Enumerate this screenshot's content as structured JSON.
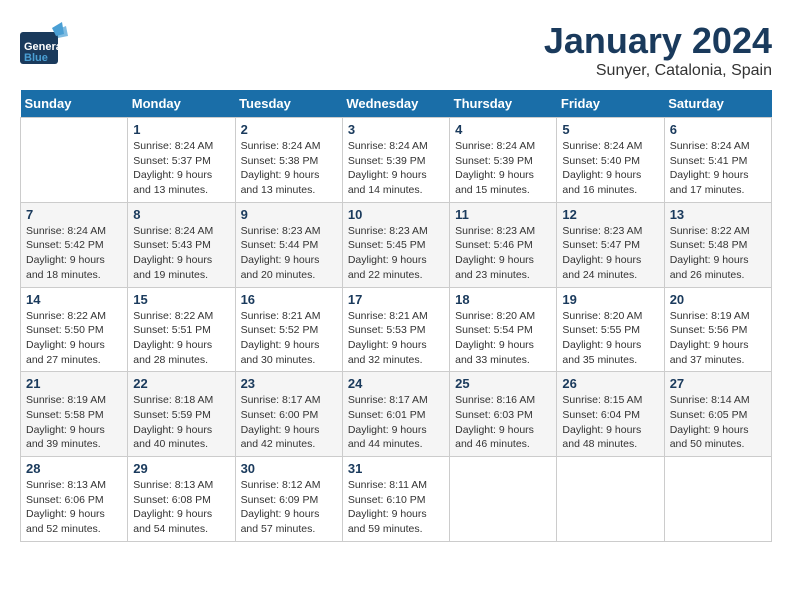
{
  "header": {
    "logo_general": "General",
    "logo_blue": "Blue",
    "month": "January 2024",
    "location": "Sunyer, Catalonia, Spain"
  },
  "days_of_week": [
    "Sunday",
    "Monday",
    "Tuesday",
    "Wednesday",
    "Thursday",
    "Friday",
    "Saturday"
  ],
  "weeks": [
    [
      {
        "day": "",
        "empty": true
      },
      {
        "day": "1",
        "sunrise": "Sunrise: 8:24 AM",
        "sunset": "Sunset: 5:37 PM",
        "daylight": "Daylight: 9 hours and 13 minutes."
      },
      {
        "day": "2",
        "sunrise": "Sunrise: 8:24 AM",
        "sunset": "Sunset: 5:38 PM",
        "daylight": "Daylight: 9 hours and 13 minutes."
      },
      {
        "day": "3",
        "sunrise": "Sunrise: 8:24 AM",
        "sunset": "Sunset: 5:39 PM",
        "daylight": "Daylight: 9 hours and 14 minutes."
      },
      {
        "day": "4",
        "sunrise": "Sunrise: 8:24 AM",
        "sunset": "Sunset: 5:39 PM",
        "daylight": "Daylight: 9 hours and 15 minutes."
      },
      {
        "day": "5",
        "sunrise": "Sunrise: 8:24 AM",
        "sunset": "Sunset: 5:40 PM",
        "daylight": "Daylight: 9 hours and 16 minutes."
      },
      {
        "day": "6",
        "sunrise": "Sunrise: 8:24 AM",
        "sunset": "Sunset: 5:41 PM",
        "daylight": "Daylight: 9 hours and 17 minutes."
      }
    ],
    [
      {
        "day": "7",
        "sunrise": "Sunrise: 8:24 AM",
        "sunset": "Sunset: 5:42 PM",
        "daylight": "Daylight: 9 hours and 18 minutes."
      },
      {
        "day": "8",
        "sunrise": "Sunrise: 8:24 AM",
        "sunset": "Sunset: 5:43 PM",
        "daylight": "Daylight: 9 hours and 19 minutes."
      },
      {
        "day": "9",
        "sunrise": "Sunrise: 8:23 AM",
        "sunset": "Sunset: 5:44 PM",
        "daylight": "Daylight: 9 hours and 20 minutes."
      },
      {
        "day": "10",
        "sunrise": "Sunrise: 8:23 AM",
        "sunset": "Sunset: 5:45 PM",
        "daylight": "Daylight: 9 hours and 22 minutes."
      },
      {
        "day": "11",
        "sunrise": "Sunrise: 8:23 AM",
        "sunset": "Sunset: 5:46 PM",
        "daylight": "Daylight: 9 hours and 23 minutes."
      },
      {
        "day": "12",
        "sunrise": "Sunrise: 8:23 AM",
        "sunset": "Sunset: 5:47 PM",
        "daylight": "Daylight: 9 hours and 24 minutes."
      },
      {
        "day": "13",
        "sunrise": "Sunrise: 8:22 AM",
        "sunset": "Sunset: 5:48 PM",
        "daylight": "Daylight: 9 hours and 26 minutes."
      }
    ],
    [
      {
        "day": "14",
        "sunrise": "Sunrise: 8:22 AM",
        "sunset": "Sunset: 5:50 PM",
        "daylight": "Daylight: 9 hours and 27 minutes."
      },
      {
        "day": "15",
        "sunrise": "Sunrise: 8:22 AM",
        "sunset": "Sunset: 5:51 PM",
        "daylight": "Daylight: 9 hours and 28 minutes."
      },
      {
        "day": "16",
        "sunrise": "Sunrise: 8:21 AM",
        "sunset": "Sunset: 5:52 PM",
        "daylight": "Daylight: 9 hours and 30 minutes."
      },
      {
        "day": "17",
        "sunrise": "Sunrise: 8:21 AM",
        "sunset": "Sunset: 5:53 PM",
        "daylight": "Daylight: 9 hours and 32 minutes."
      },
      {
        "day": "18",
        "sunrise": "Sunrise: 8:20 AM",
        "sunset": "Sunset: 5:54 PM",
        "daylight": "Daylight: 9 hours and 33 minutes."
      },
      {
        "day": "19",
        "sunrise": "Sunrise: 8:20 AM",
        "sunset": "Sunset: 5:55 PM",
        "daylight": "Daylight: 9 hours and 35 minutes."
      },
      {
        "day": "20",
        "sunrise": "Sunrise: 8:19 AM",
        "sunset": "Sunset: 5:56 PM",
        "daylight": "Daylight: 9 hours and 37 minutes."
      }
    ],
    [
      {
        "day": "21",
        "sunrise": "Sunrise: 8:19 AM",
        "sunset": "Sunset: 5:58 PM",
        "daylight": "Daylight: 9 hours and 39 minutes."
      },
      {
        "day": "22",
        "sunrise": "Sunrise: 8:18 AM",
        "sunset": "Sunset: 5:59 PM",
        "daylight": "Daylight: 9 hours and 40 minutes."
      },
      {
        "day": "23",
        "sunrise": "Sunrise: 8:17 AM",
        "sunset": "Sunset: 6:00 PM",
        "daylight": "Daylight: 9 hours and 42 minutes."
      },
      {
        "day": "24",
        "sunrise": "Sunrise: 8:17 AM",
        "sunset": "Sunset: 6:01 PM",
        "daylight": "Daylight: 9 hours and 44 minutes."
      },
      {
        "day": "25",
        "sunrise": "Sunrise: 8:16 AM",
        "sunset": "Sunset: 6:03 PM",
        "daylight": "Daylight: 9 hours and 46 minutes."
      },
      {
        "day": "26",
        "sunrise": "Sunrise: 8:15 AM",
        "sunset": "Sunset: 6:04 PM",
        "daylight": "Daylight: 9 hours and 48 minutes."
      },
      {
        "day": "27",
        "sunrise": "Sunrise: 8:14 AM",
        "sunset": "Sunset: 6:05 PM",
        "daylight": "Daylight: 9 hours and 50 minutes."
      }
    ],
    [
      {
        "day": "28",
        "sunrise": "Sunrise: 8:13 AM",
        "sunset": "Sunset: 6:06 PM",
        "daylight": "Daylight: 9 hours and 52 minutes."
      },
      {
        "day": "29",
        "sunrise": "Sunrise: 8:13 AM",
        "sunset": "Sunset: 6:08 PM",
        "daylight": "Daylight: 9 hours and 54 minutes."
      },
      {
        "day": "30",
        "sunrise": "Sunrise: 8:12 AM",
        "sunset": "Sunset: 6:09 PM",
        "daylight": "Daylight: 9 hours and 57 minutes."
      },
      {
        "day": "31",
        "sunrise": "Sunrise: 8:11 AM",
        "sunset": "Sunset: 6:10 PM",
        "daylight": "Daylight: 9 hours and 59 minutes."
      },
      {
        "day": "",
        "empty": true
      },
      {
        "day": "",
        "empty": true
      },
      {
        "day": "",
        "empty": true
      }
    ]
  ]
}
